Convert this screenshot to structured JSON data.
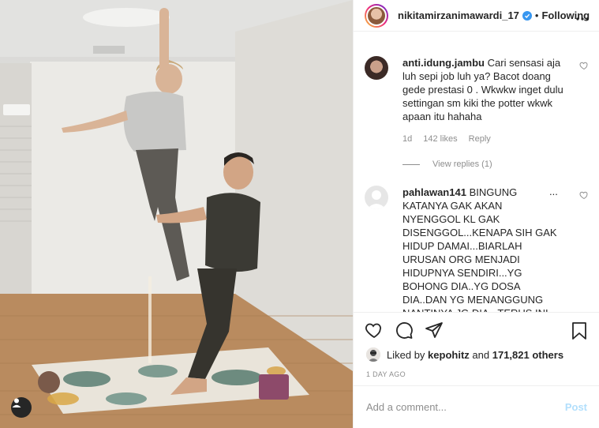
{
  "post": {
    "username": "nikitamirzanimawardi_17",
    "separator": "•",
    "follow_status": "Following",
    "more_icon": "more-horizontal-icon"
  },
  "comments": [
    {
      "username": "anti.idung.jambu",
      "text": "Cari sensasi aja luh sepi job luh ya? Bacot doang gede prestasi 0 . Wkwkw inget dulu settingan sm kiki the potter wkwk apaan itu hahaha",
      "age": "1d",
      "likes": "142 likes",
      "reply": "Reply",
      "view_replies": "View replies (1)"
    },
    {
      "username": "pahlawan141",
      "text": "BINGUNG KATANYA GAK AKAN NYENGGOL KL GAK DISENGGOL...KENAPA SIH GAK HIDUP DAMAI...BIARLAH URUSAN ORG MENJADI HIDUPNYA SENDIRI...YG BOHONG DIA..YG DOSA DIA..DAN YG MENANGGUNG NANTINYA JG DIA...TERUS INI DI MANA HEBATNYA KALAU BUKAN",
      "overflow": "..."
    }
  ],
  "likes": {
    "prefix": "Liked by",
    "user": "kepohitz",
    "conjunction": "and",
    "count": "171,821 others"
  },
  "date": "1 DAY AGO",
  "composer": {
    "placeholder": "Add a comment...",
    "post_label": "Post"
  },
  "colors": {
    "verified": "#3897f0",
    "post_disabled": "#b2dffc",
    "muted_text": "#8e8e8e"
  }
}
